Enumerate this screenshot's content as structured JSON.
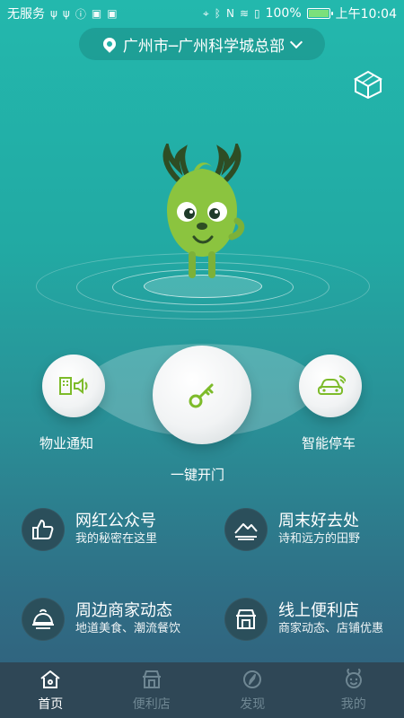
{
  "status_bar": {
    "carrier": "无服务",
    "battery_percent": "100%",
    "time": "上午10:04"
  },
  "location": {
    "text": "广州市─广州科学城总部"
  },
  "actions": {
    "left_label": "物业通知",
    "center_label": "一键开门",
    "right_label": "智能停车"
  },
  "features": [
    {
      "title": "网红公众号",
      "subtitle": "我的秘密在这里",
      "icon": "thumbs-up-icon"
    },
    {
      "title": "周末好去处",
      "subtitle": "诗和远方的田野",
      "icon": "mountain-icon"
    },
    {
      "title": "周边商家动态",
      "subtitle": "地道美食、潮流餐饮",
      "icon": "cloche-icon"
    },
    {
      "title": "线上便利店",
      "subtitle": "商家动态、店铺优惠",
      "icon": "store-icon"
    }
  ],
  "tabs": [
    {
      "label": "首页",
      "active": true,
      "icon": "home-icon"
    },
    {
      "label": "便利店",
      "active": false,
      "icon": "store-icon"
    },
    {
      "label": "发现",
      "active": false,
      "icon": "compass-icon"
    },
    {
      "label": "我的",
      "active": false,
      "icon": "deer-icon"
    }
  ],
  "colors": {
    "accent": "#22b1a8",
    "tabbar_bg": "#2f4756",
    "feature_icon_bg": "#2b4f5b",
    "mascot_green": "#8bc43f",
    "key_green": "#7dbb2a"
  }
}
